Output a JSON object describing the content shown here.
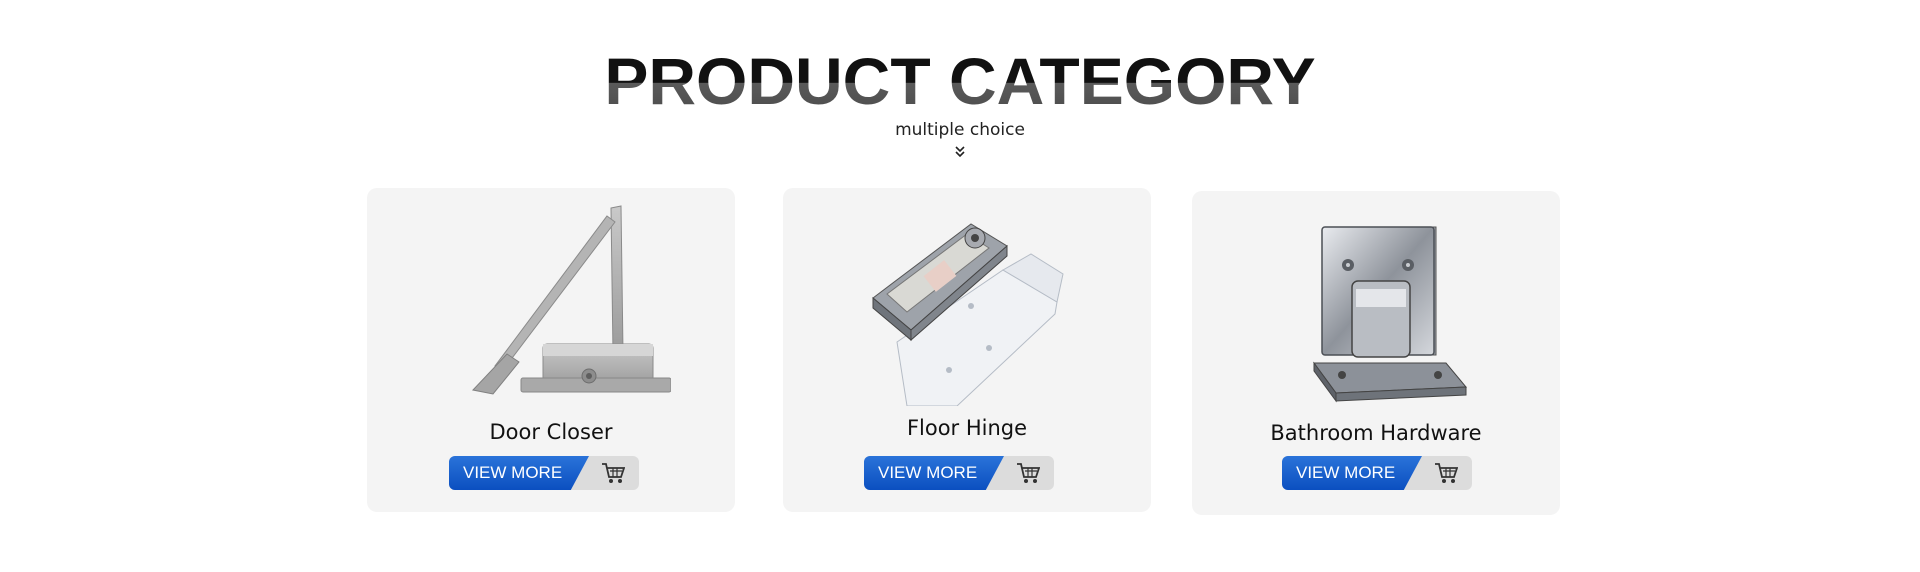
{
  "header": {
    "title": "PRODUCT CATEGORY",
    "subtitle": "multiple choice",
    "scroll_hint_icon": "double-chevron-down-icon"
  },
  "categories": [
    {
      "name": "Door Closer",
      "button_label": "VIEW MORE",
      "image": "door-closer-image",
      "cart_icon": "shopping-cart-icon"
    },
    {
      "name": "Floor Hinge",
      "button_label": "VIEW MORE",
      "image": "floor-hinge-image",
      "cart_icon": "shopping-cart-icon"
    },
    {
      "name": "Bathroom Hardware",
      "button_label": "VIEW MORE",
      "image": "bathroom-hardware-image",
      "cart_icon": "shopping-cart-icon"
    }
  ],
  "colors": {
    "button_blue": "#0b4fc0",
    "button_gray": "#dcdcdc",
    "card_background": "#f4f4f4",
    "text": "#111111"
  }
}
